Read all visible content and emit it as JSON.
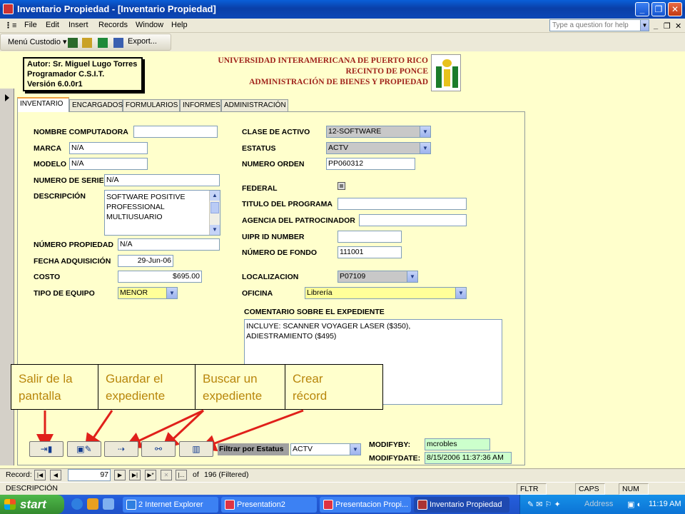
{
  "window": {
    "title": "Inventario Propiedad - [Inventario Propiedad]",
    "controls": [
      "_",
      "❐",
      "✕"
    ]
  },
  "menu": {
    "items": [
      "File",
      "Edit",
      "Insert",
      "Records",
      "Window",
      "Help"
    ],
    "help_placeholder": "Type a question for help",
    "mdi_controls": [
      "_",
      "❐",
      "✕"
    ]
  },
  "toolbar": {
    "custom_menu": "Menú Custodio ▾",
    "export": "Export..."
  },
  "header": {
    "author_lines": [
      "Autor: Sr. Miguel Lugo Torres",
      "Programador C.S.I.T.",
      "Versión 6.0.0r1"
    ],
    "university_lines": [
      "UNIVERSIDAD INTERAMERICANA DE PUERTO RICO",
      "RECINTO DE PONCE",
      "ADMINISTRACIÓN DE BIENES Y PROPIEDAD"
    ]
  },
  "tabs": [
    "INVENTARIO",
    "ENCARGADOS",
    "FORMULARIOS",
    "INFORMES",
    "ADMINISTRACIÓN"
  ],
  "form": {
    "nombre_computadora": {
      "label": "NOMBRE COMPUTADORA",
      "value": ""
    },
    "marca": {
      "label": "MARCA",
      "value": "N/A"
    },
    "modelo": {
      "label": "MODELO",
      "value": "N/A"
    },
    "numero_serie": {
      "label": "NUMERO DE SERIE",
      "value": "N/A"
    },
    "descripcion": {
      "label": "DESCRIPCIÓN",
      "lines": [
        "SOFTWARE POSITIVE",
        "PROFESSIONAL",
        "MULTIUSUARIO"
      ]
    },
    "numero_propiedad": {
      "label": "NÚMERO PROPIEDAD",
      "value": "N/A"
    },
    "fecha_adquisicion": {
      "label": "FECHA ADQUISICIÓN",
      "value": "29-Jun-06"
    },
    "costo": {
      "label": "COSTO",
      "value": "$695.00"
    },
    "tipo_equipo": {
      "label": "TIPO DE EQUIPO",
      "value": "MENOR"
    },
    "clase_activo": {
      "label": "CLASE DE ACTIVO",
      "value": "12-SOFTWARE"
    },
    "estatus": {
      "label": "ESTATUS",
      "value": "ACTV"
    },
    "numero_orden": {
      "label": "NUMERO ORDEN",
      "value": "PP060312"
    },
    "federal": {
      "label": "FEDERAL"
    },
    "titulo_programa": {
      "label": "TITULO DEL PROGRAMA",
      "value": ""
    },
    "agencia": {
      "label": "AGENCIA DEL PATROCINADOR",
      "value": ""
    },
    "uipr_id": {
      "label": "UIPR ID NUMBER",
      "value": ""
    },
    "numero_fondo": {
      "label": "NÚMERO DE FONDO",
      "value": "111001"
    },
    "localizacion": {
      "label": "LOCALIZACION",
      "value": "P07109"
    },
    "oficina": {
      "label": "OFICINA",
      "value": "Librería"
    },
    "comentario": {
      "label": "COMENTARIO SOBRE EL EXPEDIENTE",
      "lines": [
        "INCLUYE:  SCANNER VOYAGER LASER ($350),",
        "ADIESTRAMIENTO ($495)"
      ]
    }
  },
  "callouts": [
    {
      "line1": "Salir de la",
      "line2": "pantalla"
    },
    {
      "line1": "Guardar el",
      "line2": "expediente"
    },
    {
      "line1": "Buscar un",
      "line2": "expediente"
    },
    {
      "line1": "Crear",
      "line2": "récord"
    }
  ],
  "filter": {
    "label": "Filtrar por Estatus",
    "value": "ACTV"
  },
  "audit": {
    "modifyby_label": "MODIFYBY:",
    "modifyby": "mcrobles",
    "modifydate_label": "MODIFYDATE:",
    "modifydate": "8/15/2006 11:37:36 AM"
  },
  "record_nav": {
    "label": "Record:",
    "current": "97",
    "of": "of",
    "total": "196 (Filtered)"
  },
  "status": {
    "field": "DESCRIPCIÓN",
    "flags": [
      "FLTR",
      "CAPS",
      "NUM"
    ]
  },
  "taskbar": {
    "start": "start",
    "tasks": [
      "2 Internet Explorer",
      "Presentation2",
      "Presentacion Propi...",
      "Inventario Propiedad"
    ],
    "address": "Address",
    "clock": "11:19 AM"
  },
  "colors": {
    "accent_red": "#e0201a",
    "callout_text": "#b8860b",
    "university_red": "#a0241c"
  }
}
